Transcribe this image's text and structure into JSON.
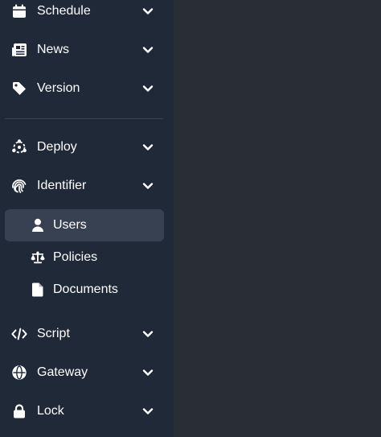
{
  "sidebar": {
    "items": [
      {
        "label": "Schedule",
        "icon": "calendar-icon"
      },
      {
        "label": "News",
        "icon": "newspaper-icon"
      },
      {
        "label": "Version",
        "icon": "tag-icon"
      },
      {
        "label": "Deploy",
        "icon": "deploy-icon"
      },
      {
        "label": "Identifier",
        "icon": "fingerprint-icon"
      },
      {
        "label": "Script",
        "icon": "code-icon"
      },
      {
        "label": "Gateway",
        "icon": "globe-icon"
      },
      {
        "label": "Lock",
        "icon": "lock-icon"
      }
    ],
    "identifier_children": [
      {
        "label": "Users",
        "icon": "user-icon",
        "active": true
      },
      {
        "label": "Policies",
        "icon": "scale-icon"
      },
      {
        "label": "Documents",
        "icon": "document-icon"
      }
    ]
  },
  "colors": {
    "sidebar_bg": "#1f2937",
    "content_bg": "#292d36",
    "active_bg": "#374151",
    "text": "#ffffff"
  }
}
